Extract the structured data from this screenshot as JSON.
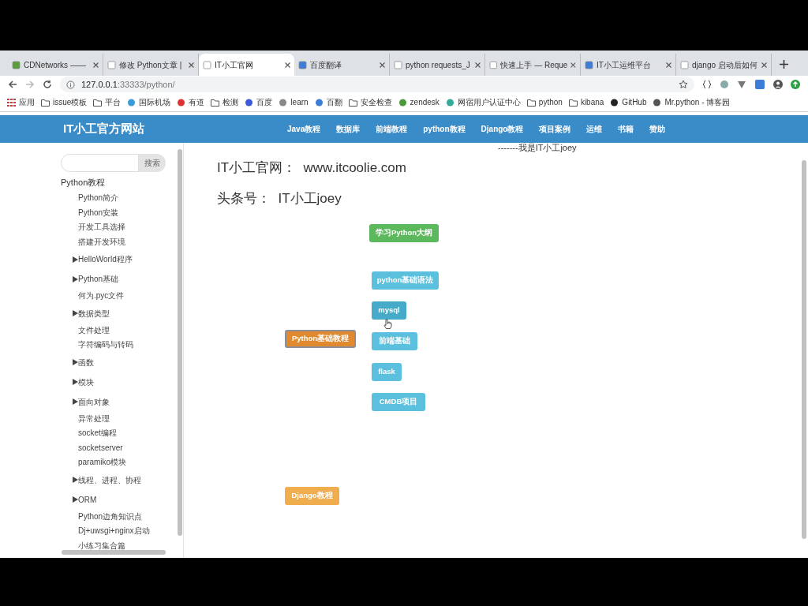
{
  "tabs": [
    {
      "title": "CDNetworks —— ",
      "selected": false
    },
    {
      "title": "修改 Python文章 |",
      "selected": false
    },
    {
      "title": "IT小工官网",
      "selected": true
    },
    {
      "title": "百度翻译",
      "selected": false
    },
    {
      "title": "python requests_J",
      "selected": false
    },
    {
      "title": "快速上手 — Reque",
      "selected": false
    },
    {
      "title": "IT小工运维平台",
      "selected": false
    },
    {
      "title": "django 启动后如何",
      "selected": false
    }
  ],
  "address": {
    "host": "127.0.0.1",
    "rest": ":33333/python/"
  },
  "bookmarks": [
    "应用",
    "issue模板",
    "平台",
    "国际机场",
    "有道",
    "检测",
    "百度",
    "learn",
    "百翻",
    "安全检查",
    "zendesk",
    "网宿用户认证中心",
    "python",
    "kibana",
    "GitHub",
    "Mr.python - 博客园"
  ],
  "site": {
    "brand": "IT小工官方网站",
    "nav": [
      "Java教程",
      "数据库",
      "前端教程",
      "python教程",
      "Django教程",
      "项目案例",
      "运维",
      "书籍",
      "赞助"
    ]
  },
  "sidebar": {
    "search_button": "搜索",
    "heading": "Python教程",
    "items": [
      {
        "label": "Python简介",
        "kind": "page"
      },
      {
        "label": "Python安装",
        "kind": "page"
      },
      {
        "label": "开发工具选择",
        "kind": "page"
      },
      {
        "label": "搭建开发环境",
        "kind": "page"
      },
      {
        "label": "HelloWorld程序",
        "kind": "group"
      },
      {
        "label": "Python基础",
        "kind": "group"
      },
      {
        "label": "何为.pyc文件",
        "kind": "page"
      },
      {
        "label": "数据类型",
        "kind": "group"
      },
      {
        "label": "文件处理",
        "kind": "page"
      },
      {
        "label": "字符编码与转码",
        "kind": "page"
      },
      {
        "label": "函数",
        "kind": "group"
      },
      {
        "label": "模块",
        "kind": "group"
      },
      {
        "label": "面向对象",
        "kind": "group"
      },
      {
        "label": "异常处理",
        "kind": "page"
      },
      {
        "label": "socket编程",
        "kind": "page"
      },
      {
        "label": "socketserver",
        "kind": "page"
      },
      {
        "label": "paramiko模块",
        "kind": "page"
      },
      {
        "label": "线程、进程、协程",
        "kind": "group"
      },
      {
        "label": "ORM",
        "kind": "group"
      },
      {
        "label": "Python边角知识点",
        "kind": "page"
      },
      {
        "label": "Dj+uwsgi+nginx启动",
        "kind": "page"
      },
      {
        "label": "小练习集合篇",
        "kind": "page"
      }
    ]
  },
  "content": {
    "signature": "-------我是IT小工joey",
    "lines": [
      "IT小工官网：  www.itcoolie.com",
      "头条号：  IT小工joey"
    ],
    "mindmap": [
      {
        "label": "学习Python大纲",
        "color": "#5cb85c",
        "selected": false
      },
      {
        "label": "python基础语法",
        "color": "#5bc0de",
        "selected": false
      },
      {
        "label": "mysql",
        "color": "#46abc9",
        "selected": false,
        "hovered": true
      },
      {
        "label": "Python基础教程",
        "color": "#e0892e",
        "selected": true
      },
      {
        "label": "前端基础",
        "color": "#5bc0de",
        "selected": false
      },
      {
        "label": "flask",
        "color": "#5bc0de",
        "selected": false
      },
      {
        "label": "CMDB项目",
        "color": "#5bc0de",
        "selected": false
      },
      {
        "label": "Django教程",
        "color": "#f0ad4e",
        "selected": false
      }
    ]
  }
}
